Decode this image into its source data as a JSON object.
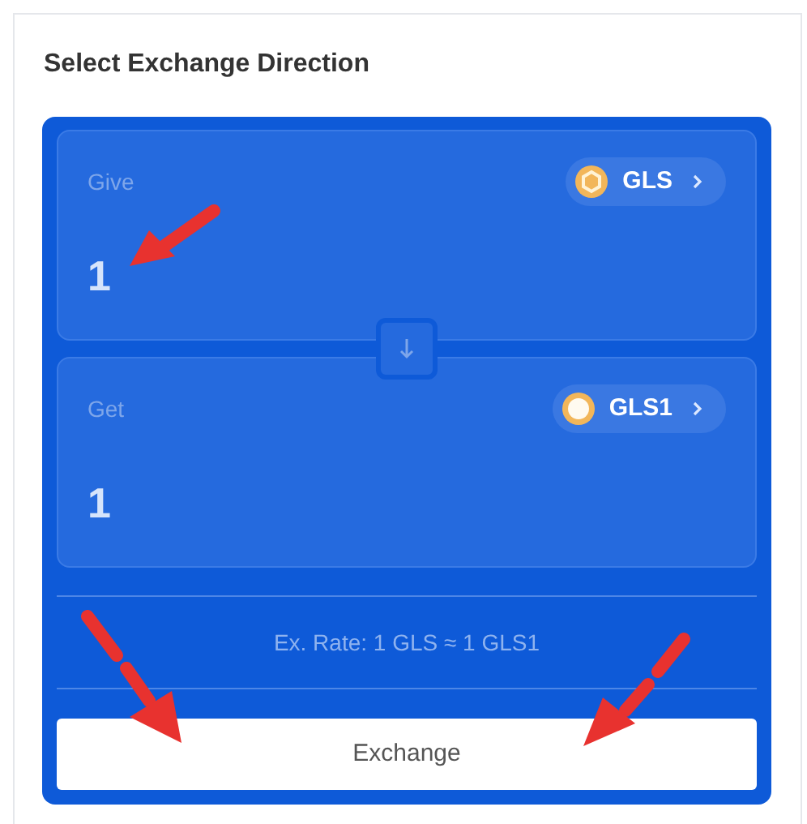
{
  "title": "Select Exchange Direction",
  "sides": [
    {
      "label": "Give",
      "amount": "1",
      "token": "GLS",
      "kind": "hex"
    },
    {
      "label": "Get",
      "amount": "1",
      "token": "GLS1",
      "kind": "ring"
    }
  ],
  "rate": "Ex. Rate: 1 GLS ≈ 1 GLS1",
  "button": "Exchange"
}
